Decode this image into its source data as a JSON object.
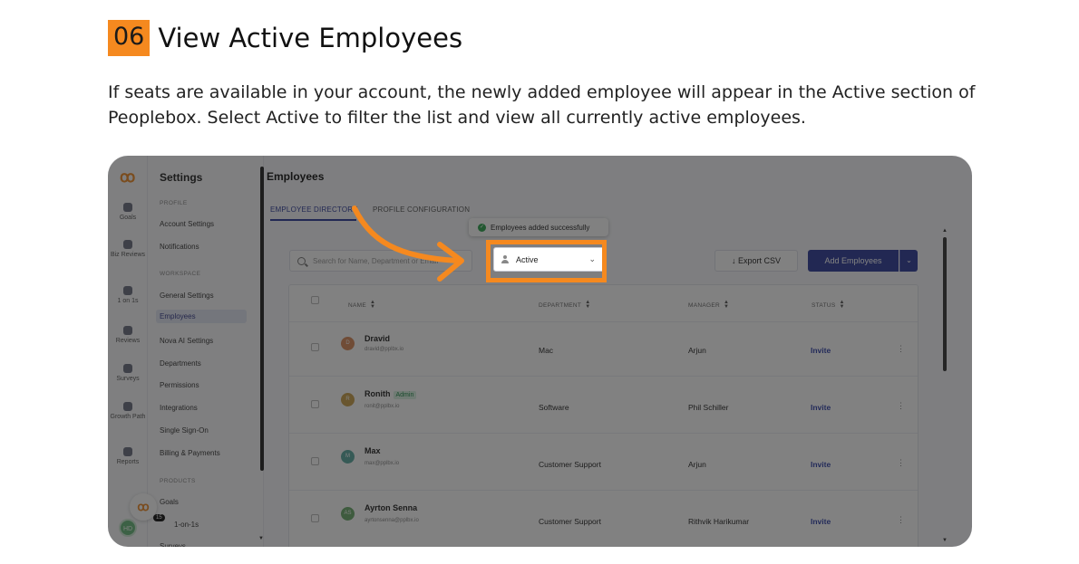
{
  "step": {
    "number": "06",
    "title": "View Active Employees",
    "description": "If seats are available in your account, the newly added employee will appear in the Active section of Peoplebox. Select Active to filter the list and view all currently active employees."
  },
  "rail": {
    "items": [
      {
        "label": "Goals",
        "icon": "target-icon"
      },
      {
        "label": "Biz Reviews",
        "icon": "presentation-icon"
      },
      {
        "label": "1 on 1s",
        "icon": "chat-icon"
      },
      {
        "label": "Reviews",
        "icon": "trophy-icon"
      },
      {
        "label": "Surveys",
        "icon": "survey-icon"
      },
      {
        "label": "Growth Path",
        "icon": "sprout-icon"
      },
      {
        "label": "Reports",
        "icon": "report-icon"
      }
    ],
    "avatar": "HD"
  },
  "settings": {
    "title": "Settings",
    "sections": {
      "profile": "PROFILE",
      "workspace": "WORKSPACE",
      "products": "PRODUCTS"
    },
    "profile_items": [
      "Account Settings",
      "Notifications"
    ],
    "workspace_items": [
      "General Settings",
      "Employees",
      "Nova AI Settings",
      "Departments",
      "Permissions",
      "Integrations",
      "Single Sign-On",
      "Billing & Payments"
    ],
    "product_items": [
      "Goals",
      "1-on-1s",
      "Surveys"
    ]
  },
  "main": {
    "title": "Employees",
    "tabs": [
      "EMPLOYEE DIRECTORY",
      "PROFILE CONFIGURATION"
    ],
    "toast": "Employees added successfully",
    "search_placeholder": "Search for Name, Department or Email",
    "filter_value": "Active",
    "export_label": "Export CSV",
    "add_label": "Add Employees",
    "columns": [
      "NAME",
      "DEPARTMENT",
      "MANAGER",
      "STATUS"
    ],
    "rows": [
      {
        "initial": "D",
        "name": "Dravid",
        "email": "dravid@pplbx.io",
        "badge": "",
        "department": "Mac",
        "manager": "Arjun",
        "status": "Invite",
        "color": "#d98a5a"
      },
      {
        "initial": "R",
        "name": "Ronith",
        "email": "ronit@pplbx.io",
        "badge": "Admin",
        "department": "Software",
        "manager": "Phil Schiller",
        "status": "Invite",
        "color": "#c9a14a"
      },
      {
        "initial": "M",
        "name": "Max",
        "email": "max@pplbx.io",
        "badge": "",
        "department": "Customer Support",
        "manager": "Arjun",
        "status": "Invite",
        "color": "#5aa8a0"
      },
      {
        "initial": "AS",
        "name": "Ayrton Senna",
        "email": "ayrtonsenna@pplbx.io",
        "badge": "",
        "department": "Customer Support",
        "manager": "Rithvik Harikumar",
        "status": "Invite",
        "color": "#6aaa6a"
      }
    ],
    "chat_badge": "15"
  },
  "colors": {
    "accent": "#f5891f",
    "primary": "#2e3b9a"
  }
}
